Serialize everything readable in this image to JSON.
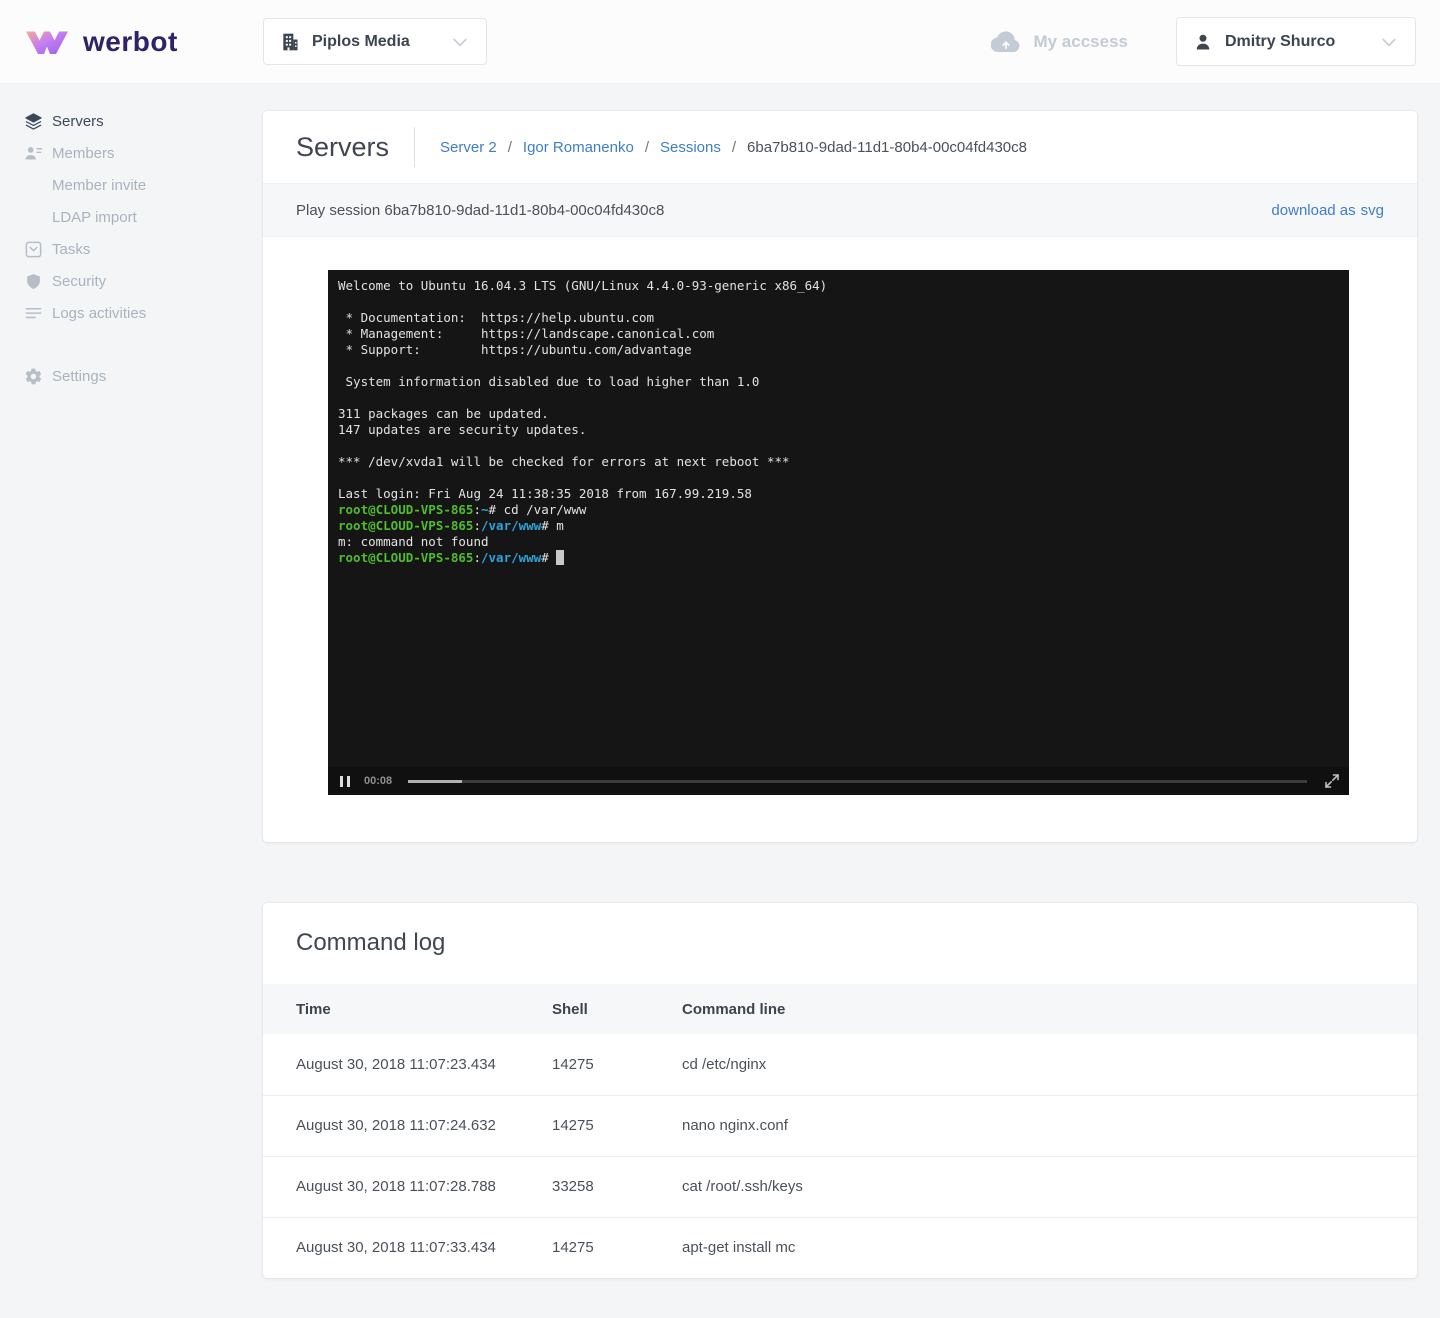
{
  "brand": {
    "name": "werbot"
  },
  "header": {
    "company_selector": {
      "label": "Piplos Media",
      "icon": "building-icon"
    },
    "my_access": {
      "label": "My accsess",
      "icon": "cloud-upload-icon"
    },
    "user_menu": {
      "name": "Dmitry Shurco",
      "icon": "user-icon"
    }
  },
  "sidebar": {
    "items": [
      {
        "label": "Servers",
        "icon": "layers-icon",
        "active": true
      },
      {
        "label": "Members",
        "icon": "members-icon"
      },
      {
        "label": "Member invite",
        "sub": true
      },
      {
        "label": "LDAP import",
        "sub": true
      },
      {
        "label": "Tasks",
        "icon": "tasks-icon"
      },
      {
        "label": "Security",
        "icon": "shield-icon"
      },
      {
        "label": "Logs activities",
        "icon": "logs-icon"
      },
      {
        "label": "Settings",
        "icon": "gear-icon"
      }
    ]
  },
  "page": {
    "title": "Servers",
    "breadcrumb": [
      {
        "label": "Server 2",
        "link": true
      },
      {
        "label": "Igor Romanenko",
        "link": true
      },
      {
        "label": "Sessions",
        "link": true
      },
      {
        "label": "6ba7b810-9dad-11d1-80b4-00c04fd430c8",
        "link": false
      }
    ]
  },
  "session_player": {
    "title": "Play session 6ba7b810-9dad-11d1-80b4-00c04fd430c8",
    "download_label": "download as",
    "download_format": "svg",
    "time": "00:08",
    "progress_percent": 6,
    "state": "playing",
    "terminal_lines": [
      [
        {
          "t": "Welcome to Ubuntu 16.04.3 LTS (GNU/Linux 4.4.0-93-generic x86_64)"
        }
      ],
      [],
      [
        {
          "t": " * Documentation:  https://help.ubuntu.com"
        }
      ],
      [
        {
          "t": " * Management:     https://landscape.canonical.com"
        }
      ],
      [
        {
          "t": " * Support:        https://ubuntu.com/advantage"
        }
      ],
      [],
      [
        {
          "t": " System information disabled due to load higher than 1.0"
        }
      ],
      [],
      [
        {
          "t": "311 packages can be updated."
        }
      ],
      [
        {
          "t": "147 updates are security updates."
        }
      ],
      [],
      [
        {
          "t": "*** /dev/xvda1 will be checked for errors at next reboot ***"
        }
      ],
      [],
      [
        {
          "t": "Last login: Fri Aug 24 11:38:35 2018 from 167.99.219.58"
        }
      ],
      [
        {
          "t": "root@CLOUD-VPS-865",
          "c": "green"
        },
        {
          "t": ":"
        },
        {
          "t": "~",
          "c": "blue"
        },
        {
          "t": "# cd /var/www"
        }
      ],
      [
        {
          "t": "root@CLOUD-VPS-865",
          "c": "green"
        },
        {
          "t": ":"
        },
        {
          "t": "/var/www",
          "c": "blue"
        },
        {
          "t": "# m"
        }
      ],
      [
        {
          "t": "m: command not found"
        }
      ],
      [
        {
          "t": "root@CLOUD-VPS-865",
          "c": "green"
        },
        {
          "t": ":"
        },
        {
          "t": "/var/www",
          "c": "blue"
        },
        {
          "t": "# "
        },
        {
          "t": " ",
          "c": "cursor"
        }
      ]
    ]
  },
  "command_log": {
    "title": "Command log",
    "columns": [
      "Time",
      "Shell",
      "Command line"
    ],
    "rows": [
      [
        "August 30, 2018 11:07:23.434",
        "14275",
        "cd /etc/nginx"
      ],
      [
        "August 30, 2018 11:07:24.632",
        "14275",
        "nano nginx.conf"
      ],
      [
        "August 30, 2018 11:07:28.788",
        "33258",
        "cat /root/.ssh/keys"
      ],
      [
        "August 30, 2018 11:07:33.434",
        "14275",
        "apt-get install mc"
      ]
    ]
  },
  "colors": {
    "brand-text": "#2e2366",
    "link": "#3d7ec9",
    "term-bg": "#151515",
    "term-green": "#4ebe2c",
    "term-blue": "#2da4dd",
    "page-bg": "#f4f5f7",
    "strip-bg": "#f6f7f9"
  }
}
